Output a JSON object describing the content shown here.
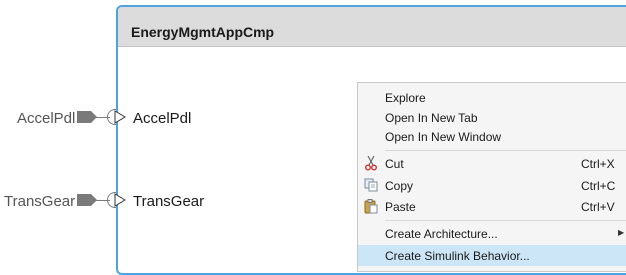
{
  "component": {
    "title": "EnergyMgmtAppCmp"
  },
  "ports": [
    {
      "external_label": "AccelPdl",
      "internal_label": "AccelPdl"
    },
    {
      "external_label": "TransGear",
      "internal_label": "TransGear"
    }
  ],
  "context_menu": {
    "items": [
      {
        "label": "Explore"
      },
      {
        "label": "Open In New Tab"
      },
      {
        "label": "Open In New Window"
      },
      {
        "label": "Cut",
        "shortcut": "Ctrl+X",
        "icon": "scissors-icon"
      },
      {
        "label": "Copy",
        "shortcut": "Ctrl+C",
        "icon": "copy-icon"
      },
      {
        "label": "Paste",
        "shortcut": "Ctrl+V",
        "icon": "paste-icon"
      },
      {
        "label": "Create Architecture...",
        "submenu": true
      },
      {
        "label": "Create Simulink Behavior...",
        "highlighted": true
      }
    ]
  },
  "colors": {
    "selection_border": "#4fa3e0",
    "menu_highlight": "#cde6f7"
  }
}
